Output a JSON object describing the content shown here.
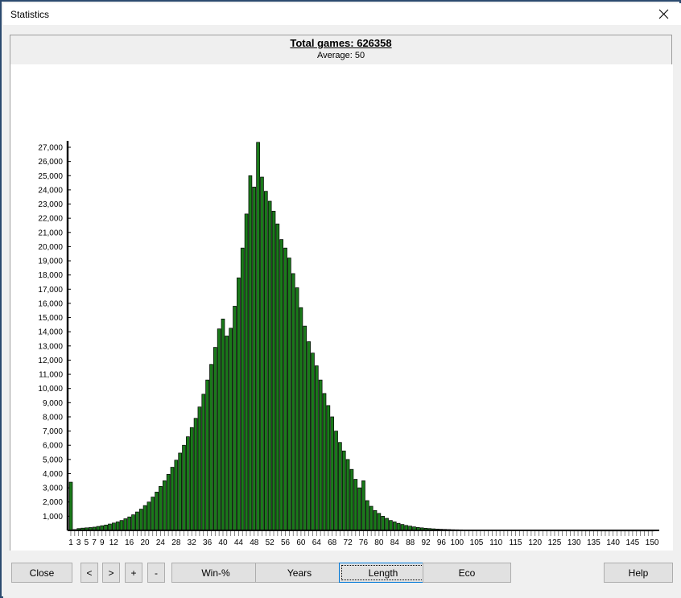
{
  "window": {
    "title": "Statistics",
    "close_icon": "close-icon"
  },
  "chart_header": {
    "title": "Total games: 626358",
    "subtitle": "Average: 50"
  },
  "buttons": {
    "close": "Close",
    "prev": "<",
    "next": ">",
    "plus": "+",
    "minus": "-",
    "winpct": "Win-%",
    "years": "Years",
    "length": "Length",
    "eco": "Eco",
    "help": "Help"
  },
  "colors": {
    "bar_fill": "#1a7a1a",
    "bar_stroke": "#000000",
    "axis": "#000000",
    "panel_bg": "#ffffff",
    "header_bg": "#efefef",
    "window_border": "#2b4a6f",
    "focus": "#0078d7"
  },
  "chart_data": {
    "type": "bar",
    "title": "Total games: 626358",
    "subtitle": "Average: 50",
    "xlabel": "",
    "ylabel": "",
    "grid": false,
    "legend": null,
    "xlim": [
      1,
      150
    ],
    "ylim": [
      0,
      27500
    ],
    "ytick_step": 1000,
    "yticks": [
      1000,
      2000,
      3000,
      4000,
      5000,
      6000,
      7000,
      8000,
      9000,
      10000,
      11000,
      12000,
      13000,
      14000,
      15000,
      16000,
      17000,
      18000,
      19000,
      20000,
      21000,
      22000,
      23000,
      24000,
      25000,
      26000,
      27000
    ],
    "ytick_labels": [
      "1,000",
      "2,000",
      "3,000",
      "4,000",
      "5,000",
      "6,000",
      "7,000",
      "8,000",
      "9,000",
      "10,000",
      "11,000",
      "12,000",
      "13,000",
      "14,000",
      "15,000",
      "16,000",
      "17,000",
      "18,000",
      "19,000",
      "20,000",
      "21,000",
      "22,000",
      "23,000",
      "24,000",
      "25,000",
      "26,000",
      "27,000"
    ],
    "xtick_labels": [
      "1",
      "3",
      "5",
      "7",
      "9",
      "12",
      "16",
      "20",
      "24",
      "28",
      "32",
      "36",
      "40",
      "44",
      "48",
      "52",
      "56",
      "60",
      "64",
      "68",
      "72",
      "76",
      "80",
      "84",
      "88",
      "92",
      "96",
      "100",
      "105",
      "110",
      "115",
      "120",
      "125",
      "130",
      "135",
      "140",
      "145",
      "150"
    ],
    "xtick_values": [
      1,
      3,
      5,
      7,
      9,
      12,
      16,
      20,
      24,
      28,
      32,
      36,
      40,
      44,
      48,
      52,
      56,
      60,
      64,
      68,
      72,
      76,
      80,
      84,
      88,
      92,
      96,
      100,
      105,
      110,
      115,
      120,
      125,
      130,
      135,
      140,
      145,
      150
    ],
    "categories": [
      1,
      2,
      3,
      4,
      5,
      6,
      7,
      8,
      9,
      10,
      11,
      12,
      13,
      14,
      15,
      16,
      17,
      18,
      19,
      20,
      21,
      22,
      23,
      24,
      25,
      26,
      27,
      28,
      29,
      30,
      31,
      32,
      33,
      34,
      35,
      36,
      37,
      38,
      39,
      40,
      41,
      42,
      43,
      44,
      45,
      46,
      47,
      48,
      49,
      50,
      51,
      52,
      53,
      54,
      55,
      56,
      57,
      58,
      59,
      60,
      61,
      62,
      63,
      64,
      65,
      66,
      67,
      68,
      69,
      70,
      71,
      72,
      73,
      74,
      75,
      76,
      77,
      78,
      79,
      80,
      81,
      82,
      83,
      84,
      85,
      86,
      87,
      88,
      89,
      90,
      91,
      92,
      93,
      94,
      95,
      96,
      97,
      98,
      99,
      100,
      101,
      102,
      103,
      104,
      105,
      106,
      107,
      108,
      109,
      110,
      111,
      112,
      113,
      114,
      115,
      116,
      117,
      118,
      119,
      120,
      121,
      122,
      123,
      124,
      125,
      126,
      127,
      128,
      129,
      130,
      131,
      132,
      133,
      134,
      135,
      136,
      137,
      138,
      139,
      140,
      141,
      142,
      143,
      144,
      145,
      146,
      147,
      148,
      149,
      150
    ],
    "values": [
      3400,
      60,
      130,
      160,
      180,
      200,
      230,
      280,
      330,
      380,
      450,
      520,
      600,
      700,
      820,
      950,
      1100,
      1300,
      1500,
      1750,
      2000,
      2350,
      2700,
      3100,
      3500,
      3950,
      4450,
      4950,
      5450,
      6000,
      6600,
      7250,
      7900,
      8700,
      9600,
      10600,
      11700,
      12900,
      14200,
      14900,
      13700,
      14250,
      15800,
      17800,
      19900,
      22300,
      25000,
      24200,
      27350,
      24900,
      23900,
      23200,
      22500,
      21600,
      20500,
      19900,
      19200,
      18100,
      17100,
      15700,
      14400,
      13300,
      12500,
      11600,
      10600,
      9650,
      8800,
      8000,
      7000,
      6200,
      5600,
      5000,
      4300,
      3600,
      3000,
      3500,
      2100,
      1700,
      1400,
      1200,
      1000,
      850,
      700,
      600,
      500,
      420,
      350,
      300,
      250,
      210,
      180,
      150,
      130,
      110,
      95,
      80,
      70,
      60,
      50,
      45,
      40,
      36,
      32,
      29,
      26,
      24,
      22,
      20,
      18,
      16,
      15,
      14,
      13,
      12,
      11,
      10,
      9,
      9,
      8,
      8,
      7,
      7,
      6,
      6,
      6,
      5,
      5,
      5,
      4,
      4,
      4,
      4,
      3,
      3,
      3,
      3,
      3,
      2,
      2,
      2,
      2,
      2,
      2,
      2,
      1,
      1,
      1,
      1,
      1,
      1
    ]
  }
}
